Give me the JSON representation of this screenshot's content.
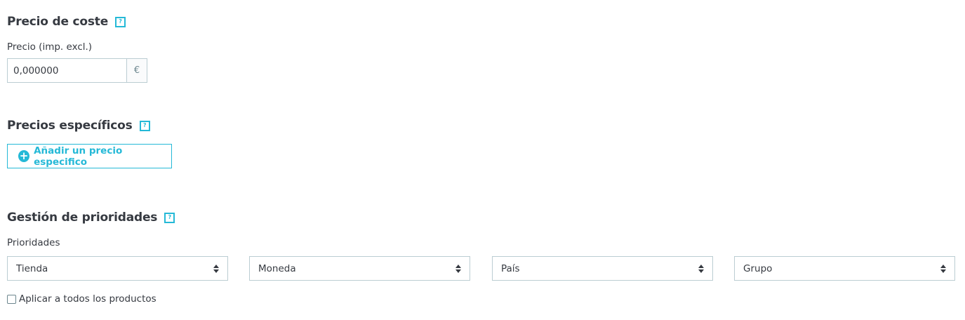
{
  "cost_price": {
    "title": "Precio de coste",
    "help_icon": "?",
    "price_label": "Precio (imp. excl.)",
    "price_value": "0,000000",
    "currency_symbol": "€"
  },
  "specific_prices": {
    "title": "Precios específicos",
    "help_icon": "?",
    "add_button_label": "Añadir un precio especifico",
    "add_icon": "+"
  },
  "priorities": {
    "title": "Gestión de prioridades",
    "help_icon": "?",
    "label": "Prioridades",
    "selects": [
      "Tienda",
      "Moneda",
      "País",
      "Grupo"
    ],
    "apply_all_label": "Aplicar a todos los productos"
  },
  "colors": {
    "accent": "#25b9d7",
    "text": "#363a41",
    "border": "#bbcdd2"
  }
}
